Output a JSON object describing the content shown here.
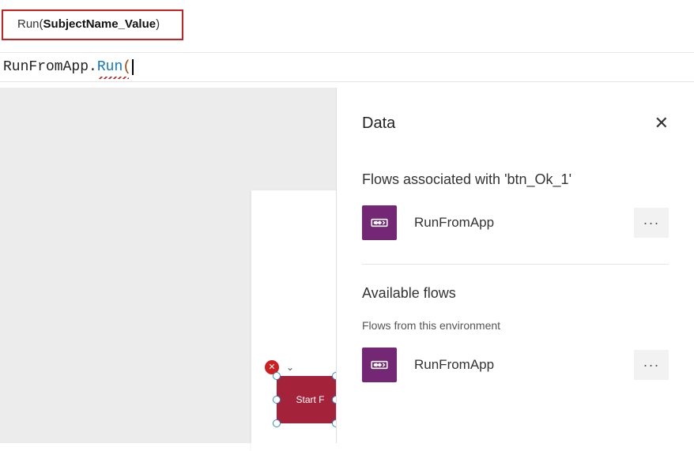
{
  "signature": {
    "function": "Run",
    "param": "SubjectName_Value"
  },
  "formula": {
    "object": "RunFromApp",
    "method": "Run"
  },
  "canvas": {
    "button_label": "Start F"
  },
  "panel": {
    "title": "Data",
    "section_assoc": "Flows associated with 'btn_Ok_1'",
    "section_avail": "Available flows",
    "section_avail_sub": "Flows from this environment",
    "flows_assoc": [
      {
        "name": "RunFromApp"
      }
    ],
    "flows_avail": [
      {
        "name": "RunFromApp"
      }
    ],
    "more_label": "···",
    "close_glyph": "✕"
  }
}
